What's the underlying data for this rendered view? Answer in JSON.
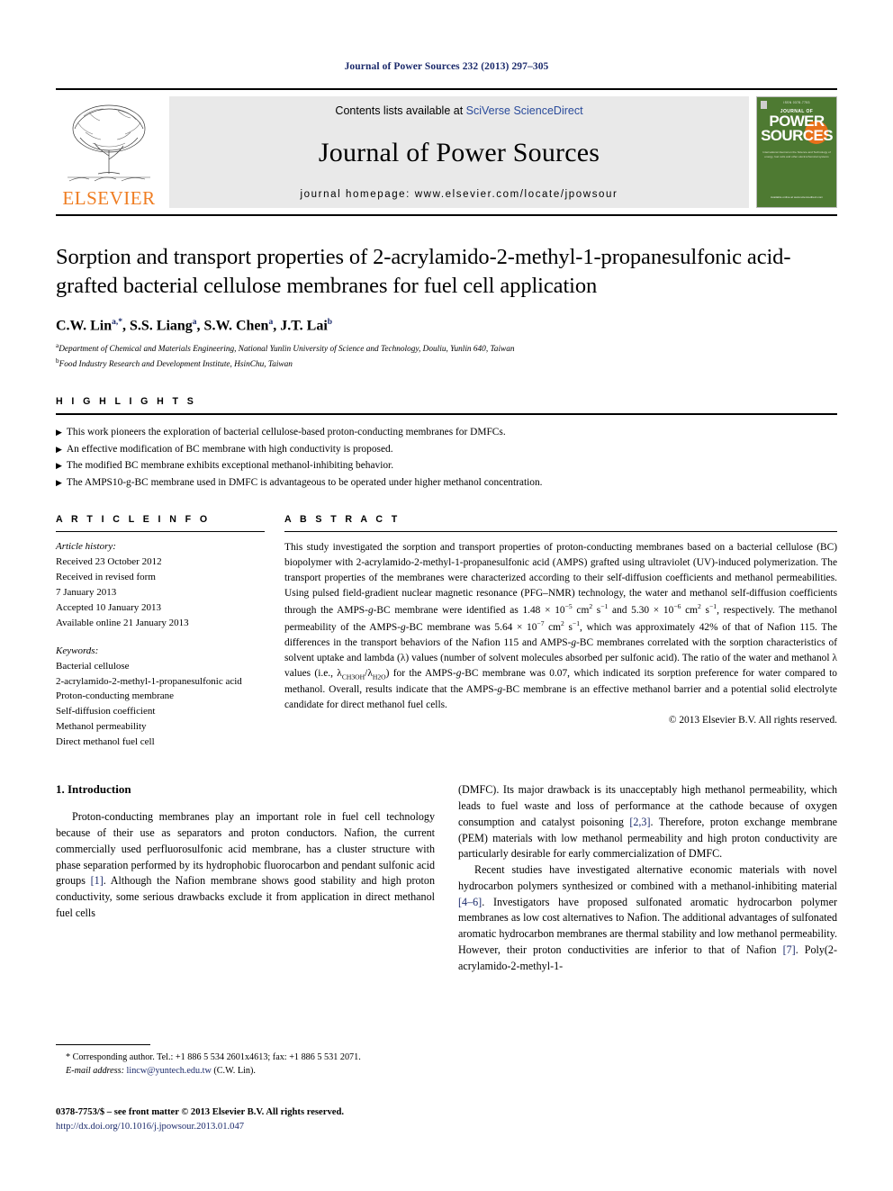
{
  "running_head": "Journal of Power Sources 232 (2013) 297–305",
  "masthead": {
    "contents_prefix": "Contents lists available at ",
    "sciencedirect": "SciVerse ScienceDirect",
    "journal_title": "Journal of Power Sources",
    "homepage": "journal homepage: www.elsevier.com/locate/jpowsour",
    "publisher": "ELSEVIER",
    "cover": {
      "top_line": "ISSN 0378-7753",
      "journal_of": "JOURNAL OF",
      "power": "POWER",
      "sources": "SOURCES",
      "subtitle": "International Journal on the Science and Technology of energy, fuel cells and other electrochemical systems",
      "footer": "Available online at www.sciencedirect.com"
    }
  },
  "article": {
    "title": "Sorption and transport properties of 2-acrylamido-2-methyl-1-propanesulfonic acid-grafted bacterial cellulose membranes for fuel cell application",
    "authors_plain": "C.W. Lin, S.S. Liang, S.W. Chen, J.T. Lai",
    "authors": [
      {
        "name": "C.W. Lin",
        "sup": "a,*"
      },
      {
        "name": "S.S. Liang",
        "sup": "a"
      },
      {
        "name": "S.W. Chen",
        "sup": "a"
      },
      {
        "name": "J.T. Lai",
        "sup": "b"
      }
    ],
    "affiliations": [
      {
        "mark": "a",
        "text": "Department of Chemical and Materials Engineering, National Yunlin University of Science and Technology, Douliu, Yunlin 640, Taiwan"
      },
      {
        "mark": "b",
        "text": "Food Industry Research and Development Institute, HsinChu, Taiwan"
      }
    ]
  },
  "highlights": {
    "heading": "H I G H L I G H T S",
    "items": [
      "This work pioneers the exploration of bacterial cellulose-based proton-conducting membranes for DMFCs.",
      "An effective modification of BC membrane with high conductivity is proposed.",
      "The modified BC membrane exhibits exceptional methanol-inhibiting behavior.",
      "The AMPS10-g-BC membrane used in DMFC is advantageous to be operated under higher methanol concentration."
    ]
  },
  "article_info": {
    "heading": "A R T I C L E   I N F O",
    "history_label": "Article history:",
    "history": [
      "Received 23 October 2012",
      "Received in revised form",
      "7 January 2013",
      "Accepted 10 January 2013",
      "Available online 21 January 2013"
    ],
    "keywords_label": "Keywords:",
    "keywords": [
      "Bacterial cellulose",
      "2-acrylamido-2-methyl-1-propanesulfonic acid",
      "Proton-conducting membrane",
      "Self-diffusion coefficient",
      "Methanol permeability",
      "Direct methanol fuel cell"
    ]
  },
  "abstract": {
    "heading": "A B S T R A C T",
    "part1": "This study investigated the sorption and transport properties of proton-conducting membranes based on a bacterial cellulose (BC) biopolymer with 2-acrylamido-2-methyl-1-propanesulfonic acid (AMPS) grafted using ultraviolet (UV)-induced polymerization. The transport properties of the membranes were characterized according to their self-diffusion coefficients and methanol permeabilities. Using pulsed field-gradient nuclear magnetic resonance (PFG–NMR) technology, the water and methanol self-diffusion coefficients through the AMPS-",
    "part1_g": "g",
    "part1b": "-BC membrane were identified as 1.48 × 10",
    "exp1": "−5",
    "part1c": " cm",
    "exp2": "2",
    "part1d": " s",
    "exp3": "−1",
    "part1e": " and 5.30 × 10",
    "exp4": "−6",
    "part1f": " cm",
    "exp5": "2",
    "part1g": " s",
    "exp6": "−1",
    "part2": ", respectively. The methanol permeability of the AMPS-",
    "part2_g": "g",
    "part2b": "-BC membrane was 5.64 × 10",
    "exp7": "−7",
    "part2c": " cm",
    "exp8": "2",
    "part2d": " s",
    "exp9": "−1",
    "part3": ", which was approximately 42% of that of Nafion 115. The differences in the transport behaviors of the Nafion 115 and AMPS-",
    "part3_g": "g",
    "part3b": "-BC membranes correlated with the sorption characteristics of solvent uptake and lambda (λ) values (number of solvent molecules absorbed per sulfonic acid). The ratio of the water and methanol λ values (i.e., λ",
    "sub1": "CH3OH",
    "part3c": "/λ",
    "sub2": "H2O",
    "part3d": ") for the AMPS-",
    "part3_g2": "g",
    "part3e": "-BC membrane was 0.07, which indicated its sorption preference for water compared to methanol. Overall, results indicate that the AMPS-",
    "part3_g3": "g",
    "part3f": "-BC membrane is an effective methanol barrier and a potential solid electrolyte candidate for direct methanol fuel cells.",
    "copyright": "© 2013 Elsevier B.V. All rights reserved."
  },
  "introduction": {
    "heading": "1. Introduction",
    "left_para": "Proton-conducting membranes play an important role in fuel cell technology because of their use as separators and proton conductors. Nafion, the current commercially used perfluorosulfonic acid membrane, has a cluster structure with phase separation performed by its hydrophobic fluorocarbon and pendant sulfonic acid groups ",
    "left_ref1": "[1]",
    "left_para_b": ". Although the Nafion membrane shows good stability and high proton conductivity, some serious drawbacks exclude it from application in direct methanol fuel cells",
    "right_para1_a": "(DMFC). Its major drawback is its unacceptably high methanol permeability, which leads to fuel waste and loss of performance at the cathode because of oxygen consumption and catalyst poisoning ",
    "right_ref1": "[2,3]",
    "right_para1_b": ". Therefore, proton exchange membrane (PEM) materials with low methanol permeability and high proton conductivity are particularly desirable for early commercialization of DMFC.",
    "right_para2_a": "Recent studies have investigated alternative economic materials with novel hydrocarbon polymers synthesized or combined with a methanol-inhibiting material ",
    "right_ref2": "[4–6]",
    "right_para2_b": ". Investigators have proposed sulfonated aromatic hydrocarbon polymer membranes as low cost alternatives to Nafion. The additional advantages of sulfonated aromatic hydrocarbon membranes are thermal stability and low methanol permeability. However, their proton conductivities are inferior to that of Nafion ",
    "right_ref3": "[7]",
    "right_para2_c": ". Poly(2-acrylamido-2-methyl-1-"
  },
  "footnotes": {
    "corresponding": "* Corresponding author. Tel.: +1 886 5 534 2601x4613; fax: +1 886 5 531 2071.",
    "email_label": "E-mail address:",
    "email": "lincw@yuntech.edu.tw",
    "email_suffix": "(C.W. Lin).",
    "issn": "0378-7753/$ – see front matter © 2013 Elsevier B.V. All rights reserved.",
    "doi": "http://dx.doi.org/10.1016/j.jpowsour.2013.01.047"
  },
  "colors": {
    "link_blue": "#1b2a6b",
    "sciencedirect_blue": "#2a4b9b",
    "elsevier_orange": "#ef7d22",
    "cover_green": "#4e7a32",
    "band_gray": "#e9e9e9"
  }
}
